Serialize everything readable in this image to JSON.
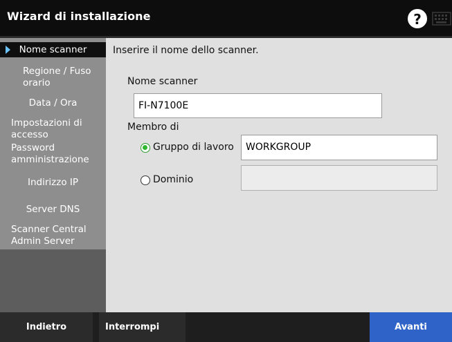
{
  "window": {
    "title": "Wizard di installazione"
  },
  "header": {
    "help_glyph": "?",
    "help_icon": "help-circle-icon",
    "keyboard_icon": "keyboard-icon"
  },
  "sidebar": {
    "items": [
      {
        "label": "Nome scanner",
        "active": true
      },
      {
        "label": "Regione / Fuso orario"
      },
      {
        "label": "Data / Ora"
      },
      {
        "label": "Impostazioni di accesso"
      },
      {
        "label": "Password amministrazione"
      },
      {
        "label": "Indirizzo IP"
      },
      {
        "label": "Server DNS"
      },
      {
        "label": "Scanner Central Admin Server"
      }
    ]
  },
  "main": {
    "instruction": "Inserire il nome dello scanner.",
    "scanner_name_label": "Nome scanner",
    "scanner_name_value": "FI-N7100E",
    "member_of_label": "Membro di",
    "workgroup_label": "Gruppo di lavoro",
    "workgroup_value": "WORKGROUP",
    "workgroup_selected": true,
    "domain_label": "Dominio",
    "domain_value": ""
  },
  "footer": {
    "back_label": "Indietro",
    "stop_label": "Interrompi",
    "next_label": "Avanti"
  },
  "colors": {
    "accent": "#2f63c8",
    "radio_selected": "#2fb82f",
    "active_arrow": "#6cc4ff"
  }
}
